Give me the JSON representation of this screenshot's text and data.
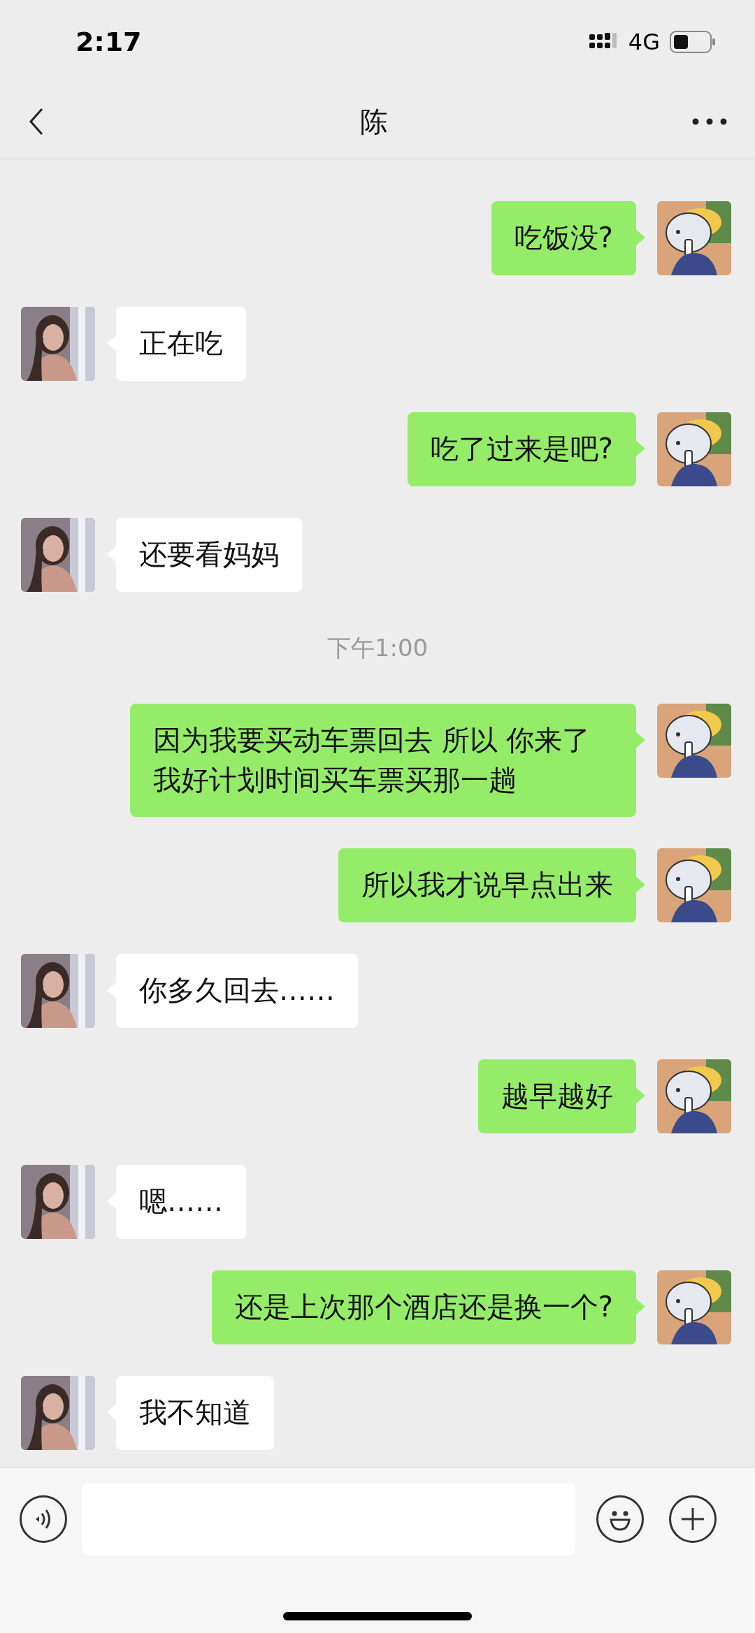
{
  "status_bar": {
    "time": "2:17",
    "network": "4G"
  },
  "header": {
    "title": "陈"
  },
  "messages": [
    {
      "kind": "sent",
      "text": "吃饭没?"
    },
    {
      "kind": "received",
      "text": "正在吃"
    },
    {
      "kind": "sent",
      "text": "吃了过来是吧?"
    },
    {
      "kind": "received",
      "text": "还要看妈妈"
    },
    {
      "kind": "timestamp",
      "text": "下午1:00"
    },
    {
      "kind": "sent",
      "text": "因为我要买动车票回去 所以 你来了我好计划时间买车票买那一趟"
    },
    {
      "kind": "sent",
      "text": "所以我才说早点出来"
    },
    {
      "kind": "received",
      "text": "你多久回去……"
    },
    {
      "kind": "sent",
      "text": "越早越好"
    },
    {
      "kind": "received",
      "text": "嗯……"
    },
    {
      "kind": "sent",
      "text": "还是上次那个酒店还是换一个?"
    },
    {
      "kind": "received",
      "text": "我不知道"
    }
  ]
}
